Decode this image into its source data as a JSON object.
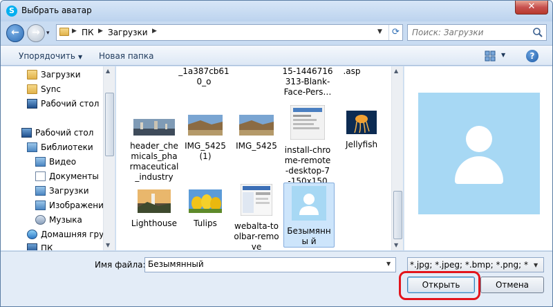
{
  "window": {
    "title": "Выбрать аватар",
    "close_glyph": "✕",
    "app_icon": "skype-icon",
    "app_icon_glyph": "S"
  },
  "nav": {
    "back_glyph": "←",
    "forward_glyph": "→",
    "dropdown_glyph": "▾"
  },
  "address": {
    "segments": [
      "ПК",
      "Загрузки"
    ],
    "refresh_glyph": "⟳"
  },
  "search": {
    "placeholder": "Поиск: Загрузки"
  },
  "toolbar": {
    "organize_label": "Упорядочить",
    "new_folder_label": "Новая папка",
    "caret": "▼",
    "help_glyph": "?"
  },
  "sidebar": {
    "items": [
      {
        "label": "Загрузки",
        "icon": "folder-icon"
      },
      {
        "label": "Sync",
        "icon": "folder-icon"
      },
      {
        "label": "Рабочий стол",
        "icon": "desktop-icon"
      },
      {
        "label": "Рабочий стол",
        "icon": "desktop-icon"
      },
      {
        "label": "Библиотеки",
        "icon": "library-icon"
      },
      {
        "label": "Видео",
        "icon": "video-icon"
      },
      {
        "label": "Документы",
        "icon": "documents-icon"
      },
      {
        "label": "Загрузки",
        "icon": "downloads-icon"
      },
      {
        "label": "Изображения",
        "icon": "pictures-icon"
      },
      {
        "label": "Музыка",
        "icon": "music-icon"
      },
      {
        "label": "Домашняя груп",
        "icon": "homegroup-icon"
      },
      {
        "label": "ПК",
        "icon": "computer-icon"
      }
    ]
  },
  "files": {
    "partial_top": [
      "_1a387cb61 0_o",
      "15-1446716 313-Blank- Face-Pers…",
      ".asp"
    ],
    "row1": [
      "header_che micals_pha rmaceutical _industry",
      "IMG_5425 (1)",
      "IMG_5425",
      "install-chro me-remote -desktop-7 -150x150",
      "Jellyfish"
    ],
    "row2": [
      "Lighthouse",
      "Tulips",
      "webalta-to olbar-remo ve",
      "Безымянны й"
    ],
    "selected_index": 3
  },
  "bottom": {
    "filename_label": "Имя файла:",
    "filename_value": "Безымянный",
    "filter_value": "*.jpg; *.jpeg; *.bmp; *.png; *.sky",
    "open_label": "Открыть",
    "cancel_label": "Отмена"
  },
  "colors": {
    "highlight": "#e3141b",
    "avatar_bg": "#a7d8f4"
  }
}
